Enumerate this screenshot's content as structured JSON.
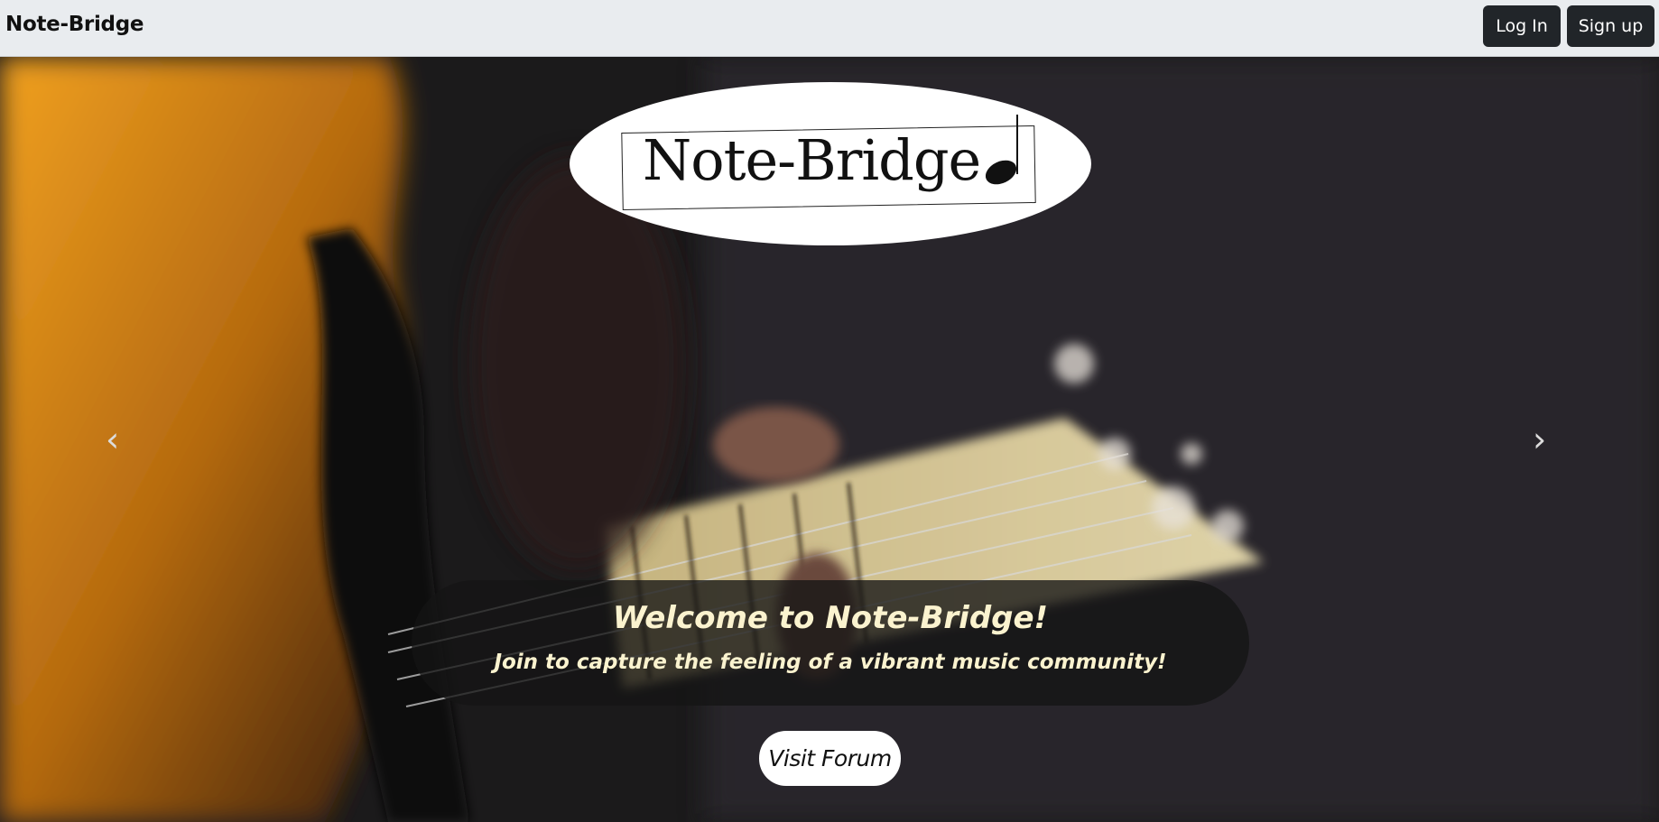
{
  "navbar": {
    "brand": "Note-Bridge",
    "login_label": "Log In",
    "signup_label": "Sign up"
  },
  "hero": {
    "logo_text": "Note-Bridge",
    "prev_arrow": "‹",
    "next_arrow": "›",
    "caption_title": "Welcome to Note-Bridge!",
    "caption_subtitle": "Join to capture the feeling of a vibrant music community!",
    "visit_label": "Visit Forum",
    "background_image": "guitar-player-photo"
  },
  "colors": {
    "navbar_bg": "#e9ecef",
    "button_dark": "#212529",
    "caption_text": "#fbf3cf"
  }
}
